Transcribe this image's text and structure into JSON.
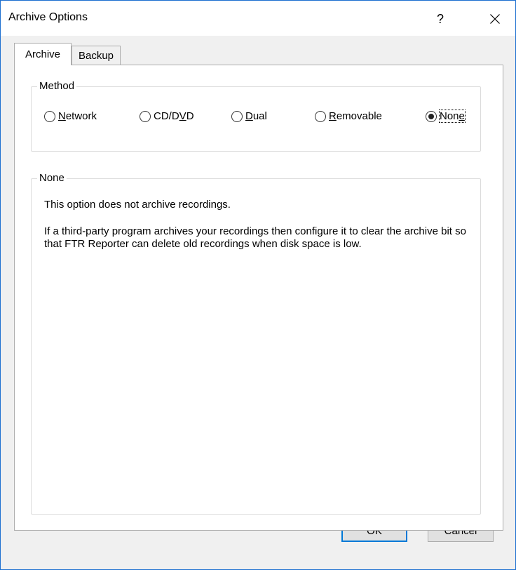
{
  "window": {
    "title": "Archive Options",
    "help_label": "?"
  },
  "tabs": [
    {
      "label": "Archive",
      "active": true
    },
    {
      "label": "Backup",
      "active": false
    }
  ],
  "method": {
    "legend": "Method",
    "options": [
      {
        "label": "Network",
        "accel_index": 0,
        "checked": false
      },
      {
        "label": "CD/DVD",
        "accel_index": 4,
        "checked": false
      },
      {
        "label": "Dual",
        "accel_index": 0,
        "checked": false
      },
      {
        "label": "Removable",
        "accel_index": 0,
        "checked": false
      },
      {
        "label": "None",
        "accel_index": 3,
        "checked": true
      }
    ]
  },
  "info": {
    "legend": "None",
    "line1": "This option does not archive recordings.",
    "line2": "If a third-party program archives your recordings then configure it to clear the archive bit so that FTR Reporter can delete old recordings when disk space is low."
  },
  "buttons": {
    "ok": "OK",
    "cancel": "Cancel"
  }
}
